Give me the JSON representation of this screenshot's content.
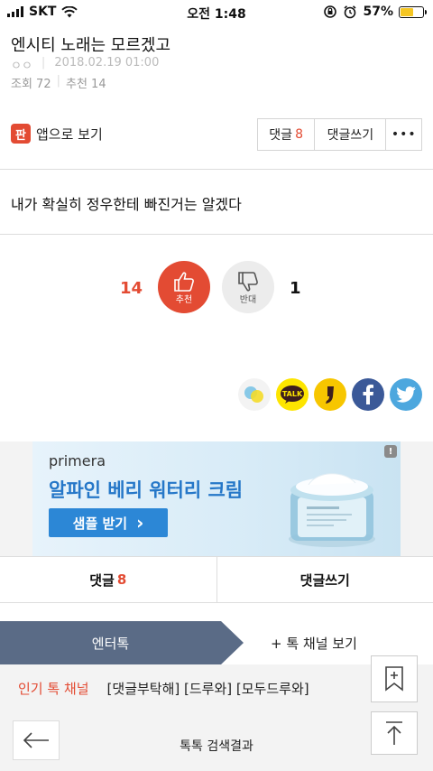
{
  "status_bar": {
    "carrier": "SKT",
    "time": "오전 1:48",
    "battery_percent": "57%",
    "battery_level": 0.57
  },
  "post": {
    "title": "엔시티 노래는 모르겠고",
    "author": "ㅇㅇ",
    "date": "2018.02.19 01:00",
    "views": "조회 72",
    "recommends": "추천 14",
    "body": "내가 확실히 정우한테 빠진거는 알겠다"
  },
  "toolbar": {
    "app_view": "앱으로 보기",
    "app_icon_glyph": "판",
    "comments_label": "댓글",
    "comments_count": "8",
    "write_comment": "댓글쓰기",
    "more": "•••"
  },
  "vote": {
    "up_count": "14",
    "up_label": "추천",
    "down_count": "1",
    "down_label": "반대"
  },
  "share": {
    "kakao_label": "TALK"
  },
  "ad": {
    "brand": "primera",
    "headline": "알파인 베리 워터리 크림",
    "cta": "샘플 받기",
    "cta_arrow": "›",
    "info": "!"
  },
  "bottom_tabs": {
    "comments_label": "댓글",
    "comments_count": "8",
    "write_comment": "댓글쓰기"
  },
  "channel": {
    "active": "엔터톡",
    "more": "+ 톡 채널 보기"
  },
  "hot": {
    "label": "인기 톡 채널",
    "items": "[댓글부탁해] [드루와] [모두드루와]"
  },
  "footer": {
    "search_result": "톡톡 검색결과"
  },
  "colors": {
    "accent": "#e34b33",
    "channel_active": "#5a6b86",
    "ad_blue": "#2c87d6"
  }
}
